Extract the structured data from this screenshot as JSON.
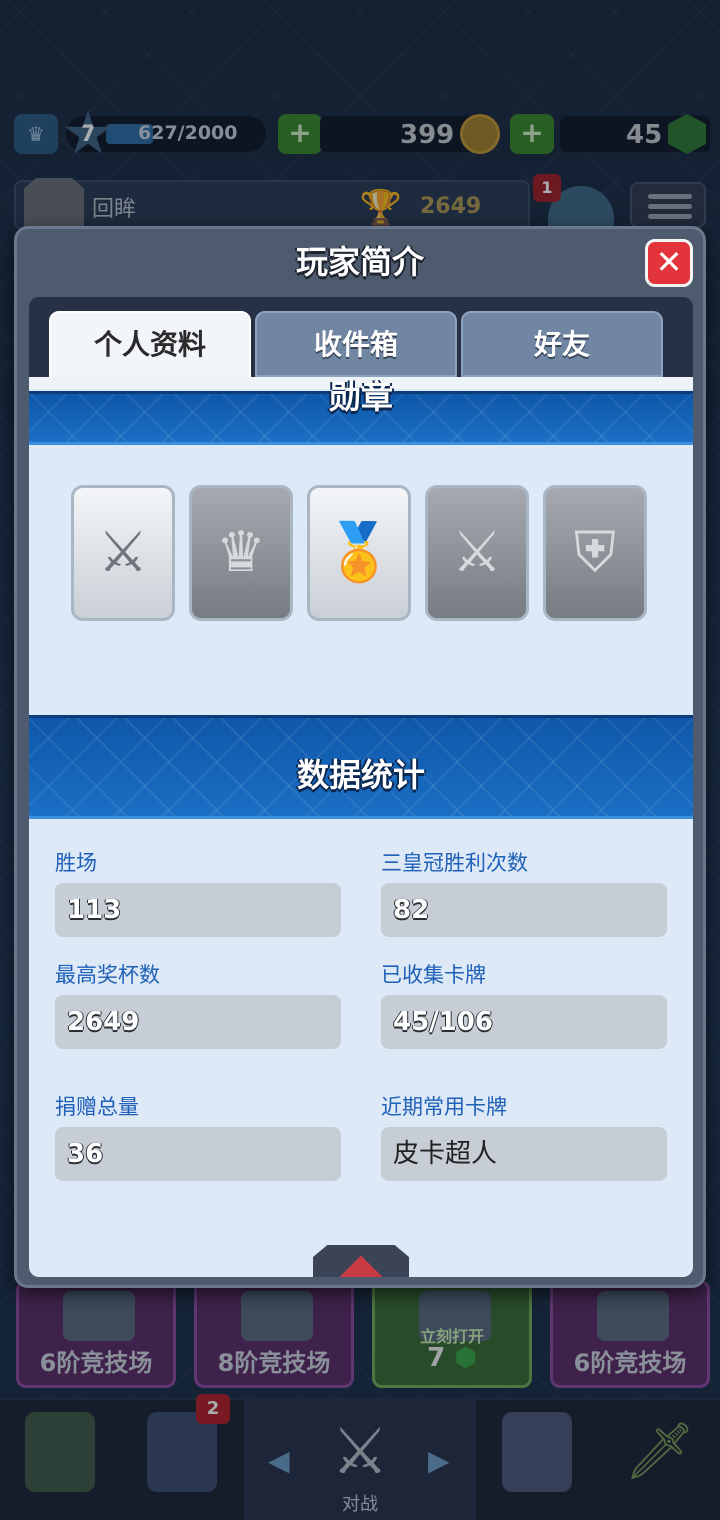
{
  "header": {
    "xp_level": "7",
    "xp_progress": "627/2000",
    "xp_fill_fraction": 0.31,
    "gold": "399",
    "gems": "45"
  },
  "player": {
    "name": "回眸",
    "trophies": "2649",
    "notification_count": "1"
  },
  "modal": {
    "title": "玩家简介",
    "close_label": "✕",
    "tabs": [
      {
        "label": "个人资料",
        "active": true
      },
      {
        "label": "收件箱",
        "active": false
      },
      {
        "label": "好友",
        "active": false
      }
    ],
    "badges_section_title": "勋章",
    "badges": [
      {
        "icon": "sword-laurel-icon",
        "style": "light"
      },
      {
        "icon": "crown-icon",
        "style": "dark"
      },
      {
        "icon": "medal-icon",
        "style": "light"
      },
      {
        "icon": "sword-laurel-icon",
        "style": "dark"
      },
      {
        "icon": "crossed-swords-shield-icon",
        "style": "dark"
      }
    ],
    "stats_section_title": "数据统计",
    "stats": [
      {
        "label": "胜场",
        "value": "113"
      },
      {
        "label": "三皇冠胜利次数",
        "value": "82"
      },
      {
        "label": "最高奖杯数",
        "value": "2649"
      },
      {
        "label": "已收集卡牌",
        "value": "45/106"
      },
      {
        "label": "捐赠总量",
        "value": "36"
      },
      {
        "label": "近期常用卡牌",
        "value": "皮卡超人"
      }
    ]
  },
  "chests": [
    {
      "label": "6阶竞技场",
      "style": "purple"
    },
    {
      "label": "8阶竞技场",
      "style": "purple"
    },
    {
      "label": "立刻打开",
      "gems": "7",
      "style": "green"
    },
    {
      "label": "6阶竞技场",
      "style": "purple"
    }
  ],
  "bottom_nav": {
    "cards_badge": "2",
    "battle_label": "对战"
  },
  "colors": {
    "banner_blue": "#1a6fc4",
    "stat_label_blue": "#1f60b8",
    "close_red": "#e2343a"
  }
}
